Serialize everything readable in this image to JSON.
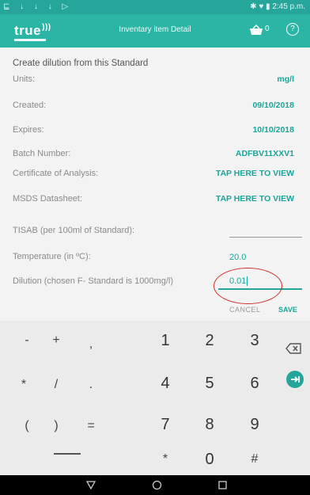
{
  "status_bar": {
    "left_icons": "⊑ ↓ ↓ ↓ ▷",
    "right_text": "✱ ♥ ▮ 2:45 p.m."
  },
  "app_bar": {
    "logo_text": "true",
    "title": "Inventary item Detail",
    "cart_count": "0",
    "help_label": "?"
  },
  "form": {
    "header": "Create dilution from this Standard",
    "fields": [
      {
        "label": "Units:",
        "value": "mg/l"
      },
      {
        "label": "Created:",
        "value": "09/10/2018"
      },
      {
        "label": "Expires:",
        "value": "10/10/2018"
      },
      {
        "label": "Batch Number:",
        "value": "ADFBV11XXV1"
      },
      {
        "label": "Certificate of Analysis:",
        "value": "TAP HERE TO VIEW"
      },
      {
        "label": "MSDS Datasheet:",
        "value": "TAP HERE TO VIEW"
      }
    ],
    "tisab_label": "TISAB (per 100ml of Standard):",
    "tisab_value": "",
    "temperature_label": "Temperature (in ºC):",
    "temperature_value": "20.0",
    "dilution_label": "Dilution (chosen F- Standard is 1000mg/l)",
    "dilution_value": "0.01",
    "cancel_label": "CANCEL",
    "save_label": "SAVE"
  },
  "keyboard": {
    "symbols": [
      "-",
      "+",
      ",",
      "*",
      "/",
      ".",
      "(",
      ")",
      "="
    ],
    "digits": [
      "1",
      "2",
      "3",
      "4",
      "5",
      "6",
      "7",
      "8",
      "9",
      "*",
      "0",
      "#"
    ]
  },
  "nav_bar": {
    "back": "▽",
    "home": "○",
    "recents": "□"
  },
  "colors": {
    "accent": "#2bb5a5",
    "value_text": "#1aa59a",
    "annotation_circle": "#d0302c"
  }
}
